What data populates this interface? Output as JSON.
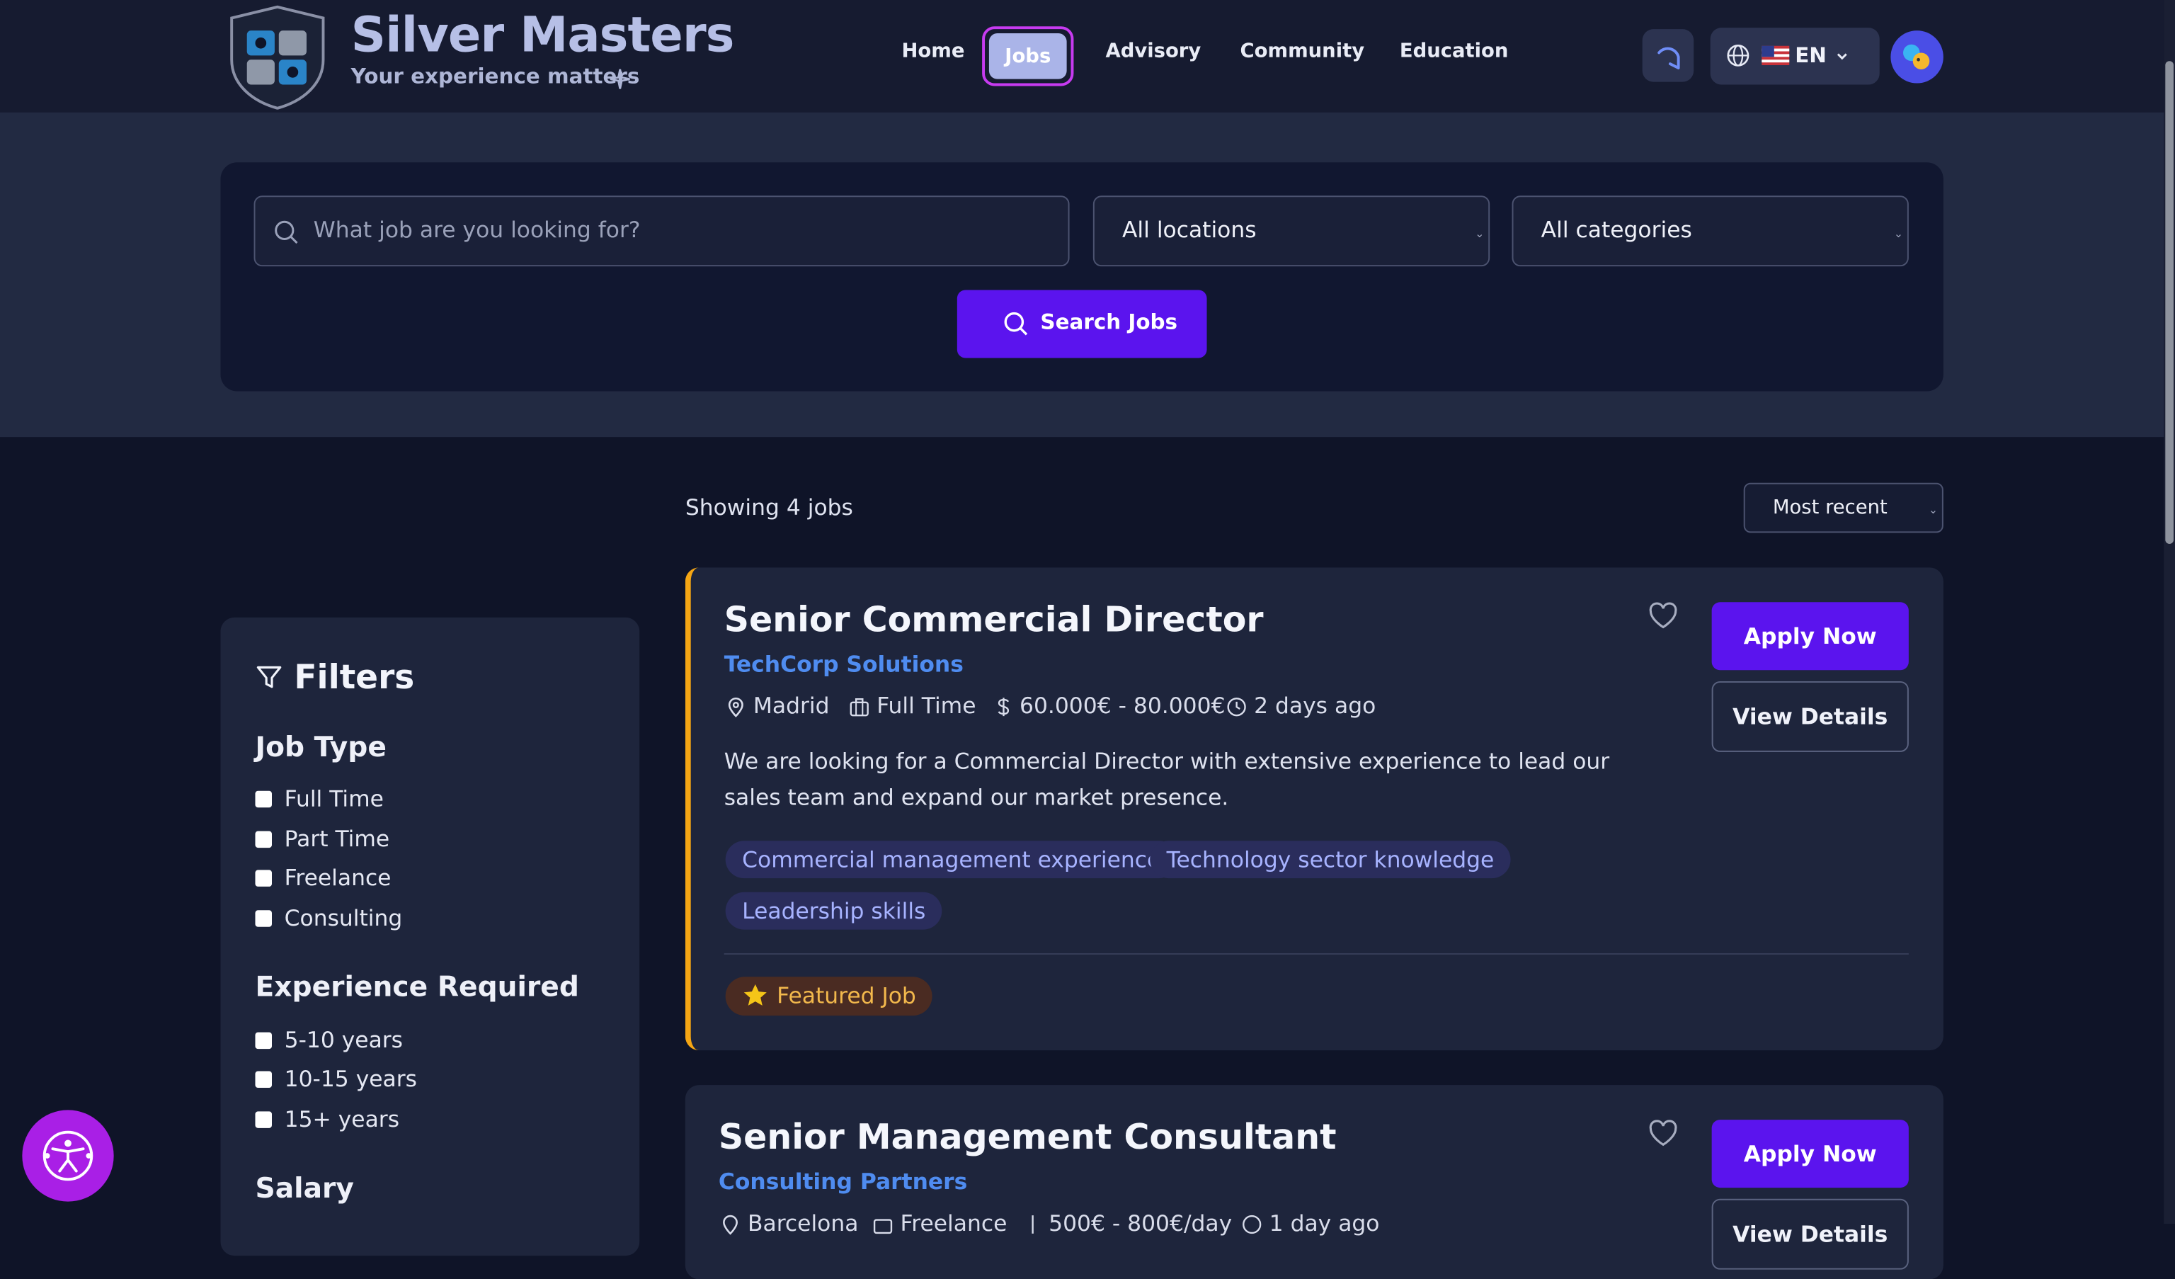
{
  "brand": {
    "name": "Silver Masters",
    "tagline": "Your experience matters"
  },
  "nav": {
    "items": [
      {
        "label": "Home"
      },
      {
        "label": "Jobs"
      },
      {
        "label": "Advisory"
      },
      {
        "label": "Community"
      },
      {
        "label": "Education"
      }
    ],
    "active": "Jobs"
  },
  "language": {
    "flag": "🇺🇸",
    "code": "EN"
  },
  "search": {
    "placeholder": "What job are you looking for?",
    "location": "All locations",
    "category": "All categories",
    "button": "Search Jobs"
  },
  "results": {
    "showing": "Showing 4 jobs",
    "sort": "Most recent"
  },
  "filters": {
    "title": "Filters",
    "job_type": {
      "heading": "Job Type",
      "options": [
        "Full Time",
        "Part Time",
        "Freelance",
        "Consulting"
      ]
    },
    "experience": {
      "heading": "Experience Required",
      "options": [
        "5-10 years",
        "10-15 years",
        "15+ years"
      ]
    },
    "salary": {
      "heading": "Salary"
    }
  },
  "jobs": [
    {
      "title": "Senior Commercial Director",
      "company": "TechCorp Solutions",
      "location": "Madrid",
      "type": "Full Time",
      "salary": "60.000€ - 80.000€",
      "posted": "2 days ago",
      "description": "We are looking for a Commercial Director with extensive experience to lead our sales team and expand our market presence.",
      "tags": [
        "Commercial management experience",
        "Technology sector knowledge",
        "Leadership skills"
      ],
      "badge": "Featured Job",
      "apply": "Apply Now",
      "details": "View Details"
    },
    {
      "title": "Senior Management Consultant",
      "company": "Consulting Partners",
      "location": "Barcelona",
      "type": "Freelance",
      "salary": "500€ - 800€/day",
      "posted": "1 day ago",
      "apply": "Apply Now",
      "details": "View Details"
    }
  ],
  "colors": {
    "accent": "#5b14ee",
    "featured_border": "#f5a614",
    "company_link": "#4f8cf0",
    "active_nav": "#aab4e8"
  }
}
